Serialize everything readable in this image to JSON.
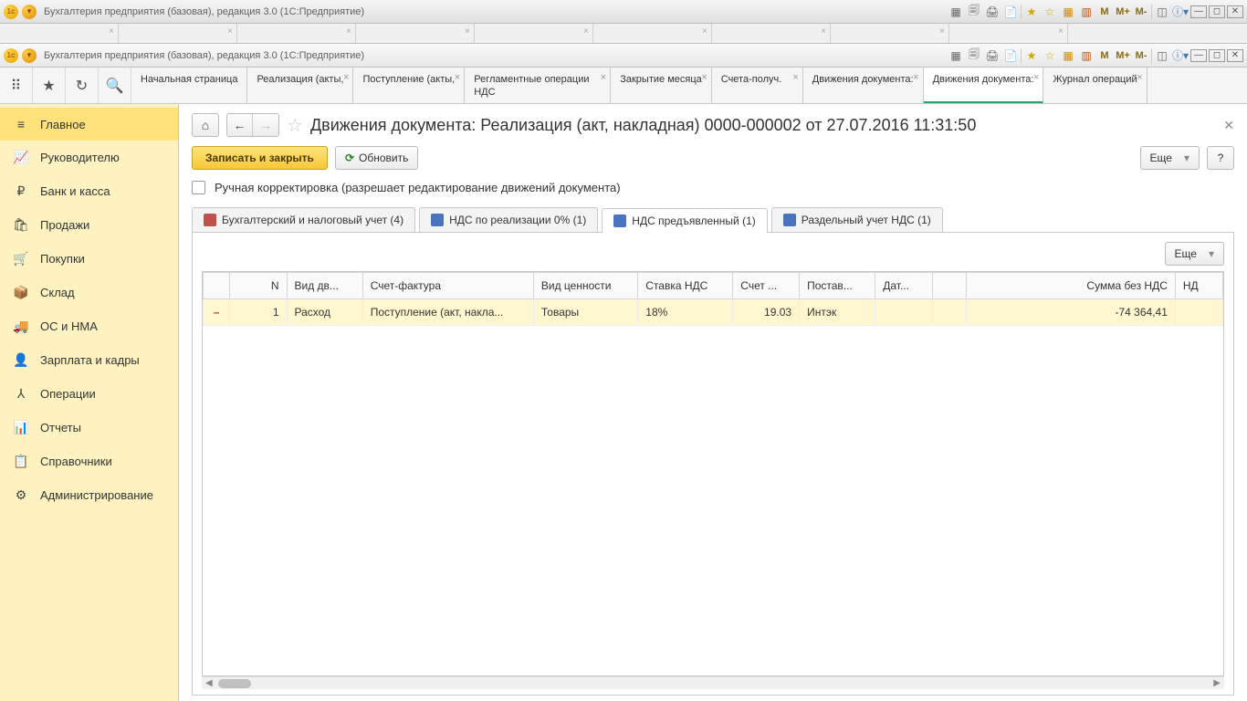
{
  "window_title": "Бухгалтерия предприятия (базовая), редакция 3.0  (1С:Предприятие)",
  "toolbar_icons": {
    "m": "M",
    "mplus": "M+",
    "mminus": "M-"
  },
  "main_tabs": [
    {
      "label": "Начальная страница",
      "closable": false
    },
    {
      "label": "Реализация (акты,",
      "closable": true
    },
    {
      "label": "Поступление (акты,",
      "closable": true
    },
    {
      "label": "Регламентные операции НДС",
      "closable": true
    },
    {
      "label": "Закрытие месяца",
      "closable": true
    },
    {
      "label": "Счета-получ.",
      "closable": true
    },
    {
      "label": "Движения документа:",
      "closable": true
    },
    {
      "label": "Движения документа:",
      "closable": true,
      "active": true
    },
    {
      "label": "Журнал операций",
      "closable": true
    }
  ],
  "sidebar": [
    {
      "icon": "≡",
      "label": "Главное",
      "active": true
    },
    {
      "icon": "📈",
      "label": "Руководителю"
    },
    {
      "icon": "₽",
      "label": "Банк и касса"
    },
    {
      "icon": "🛍",
      "label": "Продажи"
    },
    {
      "icon": "🛒",
      "label": "Покупки"
    },
    {
      "icon": "📦",
      "label": "Склад"
    },
    {
      "icon": "🚚",
      "label": "ОС и НМА"
    },
    {
      "icon": "👤",
      "label": "Зарплата и кадры"
    },
    {
      "icon": "⅄",
      "label": "Операции"
    },
    {
      "icon": "📊",
      "label": "Отчеты"
    },
    {
      "icon": "📋",
      "label": "Справочники"
    },
    {
      "icon": "⚙",
      "label": "Администрирование"
    }
  ],
  "doc": {
    "title": "Движения документа: Реализация (акт, накладная) 0000-000002 от 27.07.2016 11:31:50",
    "save_close": "Записать и закрыть",
    "refresh": "Обновить",
    "more": "Еще",
    "help": "?",
    "manual_edit": "Ручная корректировка (разрешает редактирование движений документа)"
  },
  "inner_tabs": [
    {
      "label": "Бухгалтерский и налоговый учет (4)"
    },
    {
      "label": "НДС по реализации 0% (1)"
    },
    {
      "label": "НДС предъявленный (1)",
      "active": true
    },
    {
      "label": "Раздельный учет НДС (1)"
    }
  ],
  "grid": {
    "headers": [
      "",
      "N",
      "Вид дв...",
      "Счет-фактура",
      "Вид ценности",
      "Ставка НДС",
      "Счет ...",
      "Постав...",
      "Дат...",
      "",
      "Сумма без НДС",
      "НД"
    ],
    "row": {
      "mark": "–",
      "n": "1",
      "kind": "Расход",
      "invoice": "Поступление (акт, накла...",
      "valtype": "Товары",
      "vat": "18%",
      "account": "19.03",
      "supplier": "Интэк",
      "date": "",
      "blank": "",
      "sum": "-74 364,41",
      "nd": ""
    },
    "more": "Еще"
  }
}
